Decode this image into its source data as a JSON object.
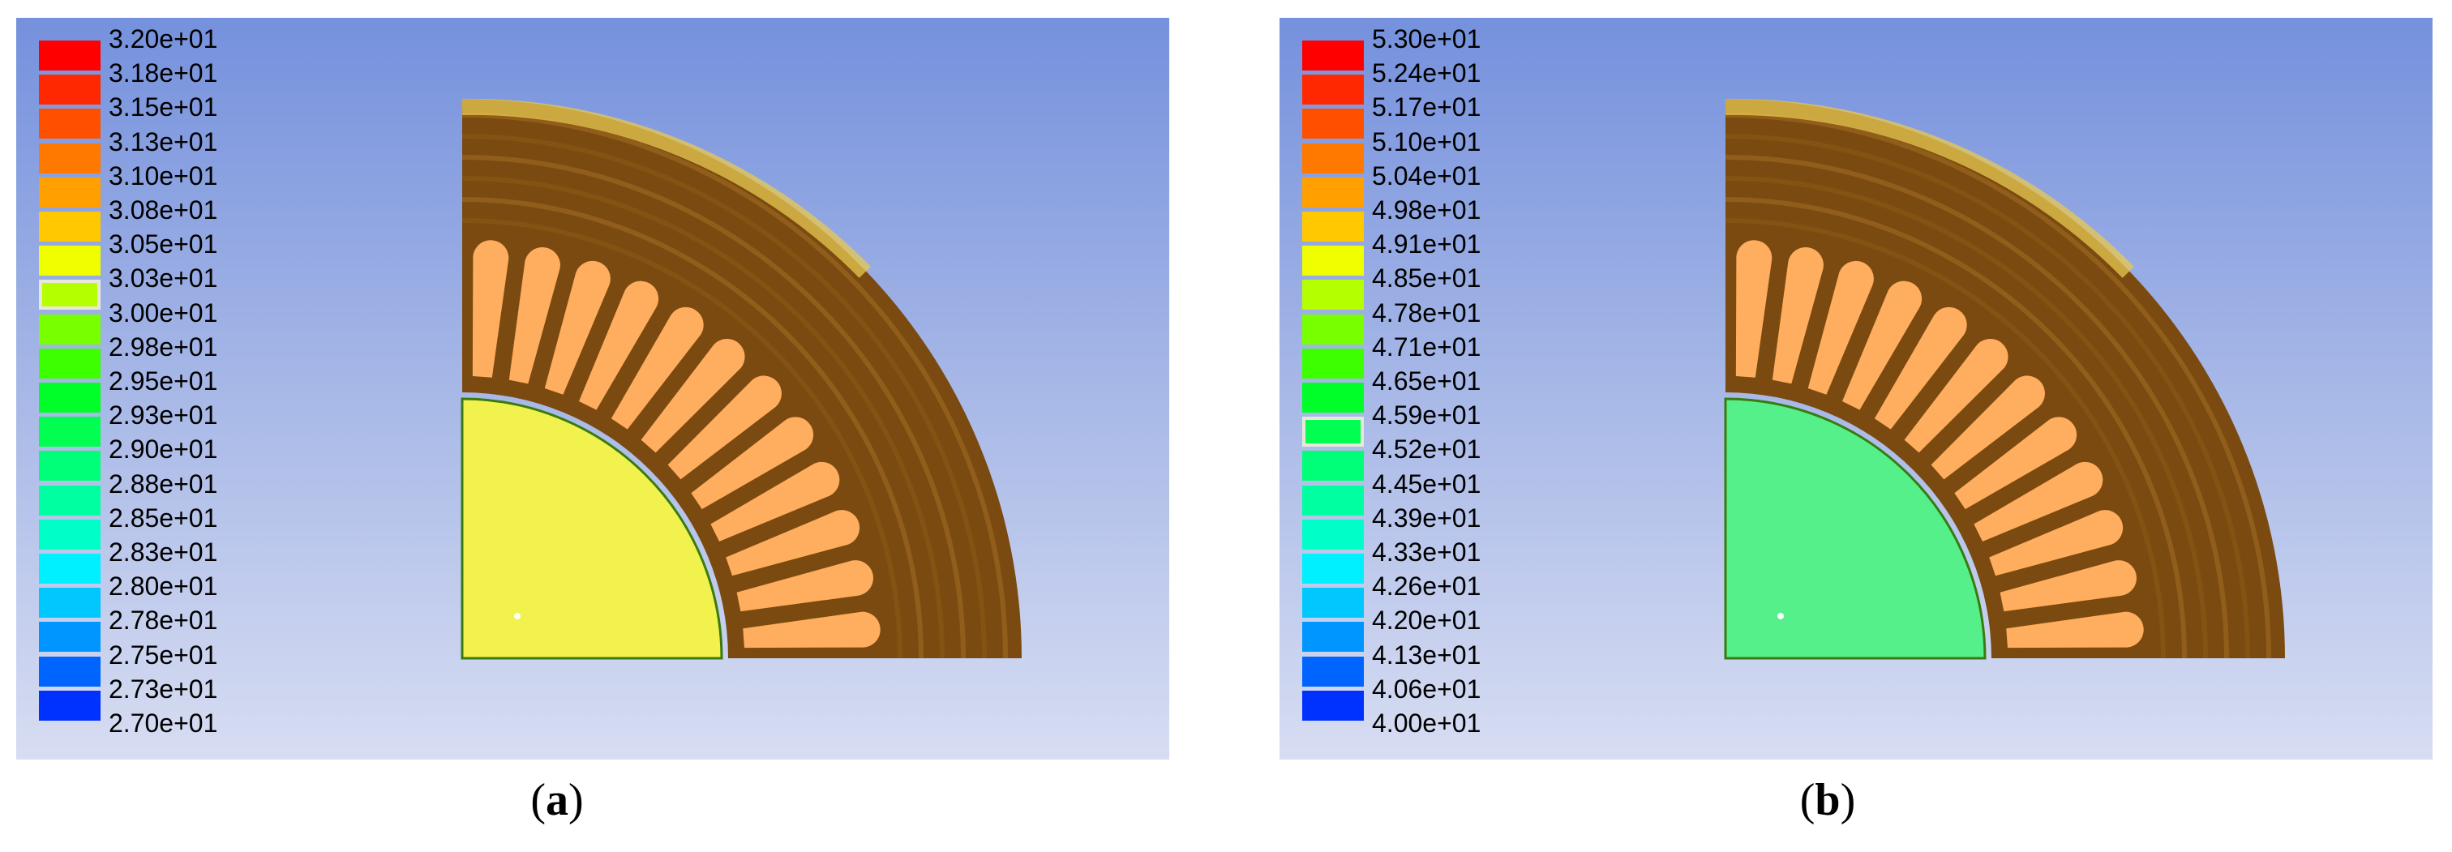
{
  "panels": [
    {
      "id": "a",
      "caption_letter": "a",
      "legend_labels": [
        "3.20e+01",
        "3.18e+01",
        "3.15e+01",
        "3.13e+01",
        "3.10e+01",
        "3.08e+01",
        "3.05e+01",
        "3.03e+01",
        "3.00e+01",
        "2.98e+01",
        "2.95e+01",
        "2.93e+01",
        "2.90e+01",
        "2.88e+01",
        "2.85e+01",
        "2.83e+01",
        "2.80e+01",
        "2.78e+01",
        "2.75e+01",
        "2.73e+01",
        "2.70e+01"
      ],
      "selected_band": 7,
      "rotor_color": "#f2f24e"
    },
    {
      "id": "b",
      "caption_letter": "b",
      "legend_labels": [
        "5.30e+01",
        "5.24e+01",
        "5.17e+01",
        "5.10e+01",
        "5.04e+01",
        "4.98e+01",
        "4.91e+01",
        "4.85e+01",
        "4.78e+01",
        "4.71e+01",
        "4.65e+01",
        "4.59e+01",
        "4.52e+01",
        "4.45e+01",
        "4.39e+01",
        "4.33e+01",
        "4.26e+01",
        "4.20e+01",
        "4.13e+01",
        "4.06e+01",
        "4.00e+01"
      ],
      "selected_band": 11,
      "rotor_color": "#55f08a"
    }
  ],
  "colormap": [
    "#ff0000",
    "#ff2800",
    "#ff5000",
    "#ff7800",
    "#ffa000",
    "#ffc800",
    "#f0ff00",
    "#b4ff00",
    "#78ff00",
    "#3cff00",
    "#00ff28",
    "#00ff50",
    "#00ff78",
    "#00ffa0",
    "#00ffc8",
    "#00f0ff",
    "#00c8ff",
    "#0096ff",
    "#0064ff",
    "#0032ff",
    "#0000ff"
  ],
  "stator_color": "#7a4a10",
  "slot_color": "#ffad5e",
  "yoke_highlight": "#e8c850"
}
